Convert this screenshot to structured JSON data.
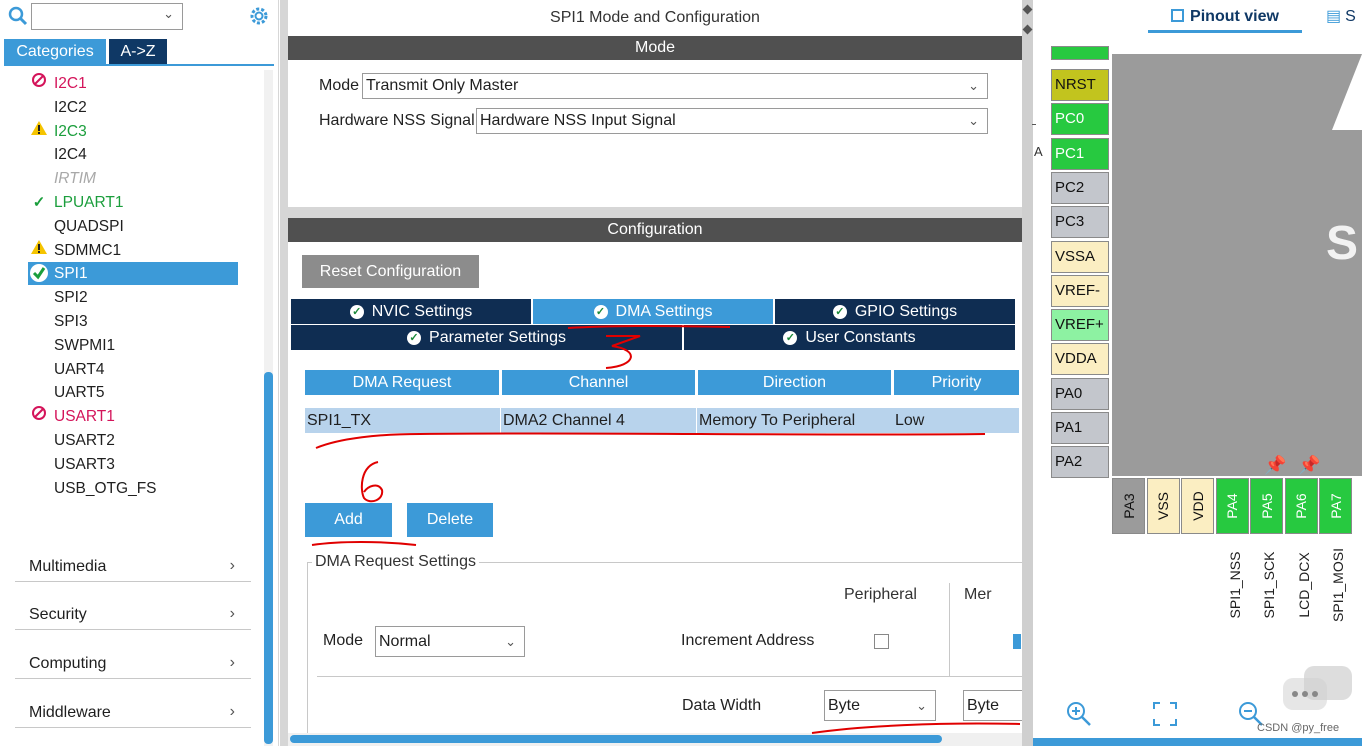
{
  "sidebar": {
    "search_value": "",
    "tabs": {
      "categories": "Categories",
      "az": "A->Z"
    },
    "peripherals": [
      {
        "label": "I2C1",
        "status": "disabled"
      },
      {
        "label": "I2C2",
        "status": "none"
      },
      {
        "label": "I2C3",
        "status": "warning"
      },
      {
        "label": "I2C4",
        "status": "none"
      },
      {
        "label": "IRTIM",
        "status": "unavailable"
      },
      {
        "label": "LPUART1",
        "status": "ok"
      },
      {
        "label": "QUADSPI",
        "status": "none"
      },
      {
        "label": "SDMMC1",
        "status": "warning"
      },
      {
        "label": "SPI1",
        "status": "selected"
      },
      {
        "label": "SPI2",
        "status": "none"
      },
      {
        "label": "SPI3",
        "status": "none"
      },
      {
        "label": "SWPMI1",
        "status": "none"
      },
      {
        "label": "UART4",
        "status": "none"
      },
      {
        "label": "UART5",
        "status": "none"
      },
      {
        "label": "USART1",
        "status": "disabled"
      },
      {
        "label": "USART2",
        "status": "none"
      },
      {
        "label": "USART3",
        "status": "none"
      },
      {
        "label": "USB_OTG_FS",
        "status": "none"
      }
    ],
    "categories": [
      "Multimedia",
      "Security",
      "Computing",
      "Middleware"
    ]
  },
  "main": {
    "title": "SPI1 Mode and Configuration",
    "mode_header": "Mode",
    "mode_label": "Mode",
    "mode_value": "Transmit Only Master",
    "nss_label": "Hardware NSS Signal",
    "nss_value": "Hardware NSS Input Signal",
    "config_header": "Configuration",
    "reset_label": "Reset Configuration",
    "tabs": {
      "nvic": "NVIC Settings",
      "dma": "DMA Settings",
      "gpio": "GPIO Settings",
      "param": "Parameter Settings",
      "user": "User Constants"
    },
    "dma_table": {
      "headers": [
        "DMA Request",
        "Channel",
        "Direction",
        "Priority"
      ],
      "row": [
        "SPI1_TX",
        "DMA2 Channel 4",
        "Memory To Peripheral",
        "Low"
      ]
    },
    "add_label": "Add",
    "delete_label": "Delete",
    "req_settings_title": "DMA Request Settings",
    "peripheral_col": "Peripheral",
    "memory_col": "Mer",
    "req_mode_label": "Mode",
    "req_mode_value": "Normal",
    "increment_label": "Increment Address",
    "data_width_label": "Data Width",
    "periph_width": "Byte",
    "mem_width": "Byte",
    "annotations": [
      "5",
      "6"
    ]
  },
  "pinout": {
    "tab_label": "Pinout view",
    "tab2_label": "S",
    "chip_letter": "S",
    "left_pins": [
      {
        "label": "NRST",
        "color": "olive"
      },
      {
        "label": "PC0",
        "color": "green"
      },
      {
        "label": "PC1",
        "color": "green"
      },
      {
        "label": "PC2",
        "color": "gray"
      },
      {
        "label": "PC3",
        "color": "gray"
      },
      {
        "label": "VSSA",
        "color": "cream"
      },
      {
        "label": "VREF-",
        "color": "cream"
      },
      {
        "label": "VREF+",
        "color": "lgreen"
      },
      {
        "label": "VDDA",
        "color": "cream"
      },
      {
        "label": "PA0",
        "color": "gray"
      },
      {
        "label": "PA1",
        "color": "gray"
      },
      {
        "label": "PA2",
        "color": "gray"
      }
    ],
    "bottom_pins": [
      {
        "label": "PA3",
        "color": "mid"
      },
      {
        "label": "VSS",
        "color": "cream"
      },
      {
        "label": "VDD",
        "color": "cream"
      },
      {
        "label": "PA4",
        "color": "green"
      },
      {
        "label": "PA5",
        "color": "green"
      },
      {
        "label": "PA6",
        "color": "green"
      },
      {
        "label": "PA7",
        "color": "green"
      }
    ],
    "signals": [
      "SPI1_NSS",
      "SPI1_SCK",
      "LCD_DCX",
      "SPI1_MOSI"
    ],
    "side_marks": [
      "A"
    ],
    "watermark": "CSDN @py_free"
  },
  "colors": {
    "accent": "#3c9ad8",
    "navy": "#0f2d52",
    "pin_green": "#27c940",
    "annotation_red": "#e00000"
  }
}
